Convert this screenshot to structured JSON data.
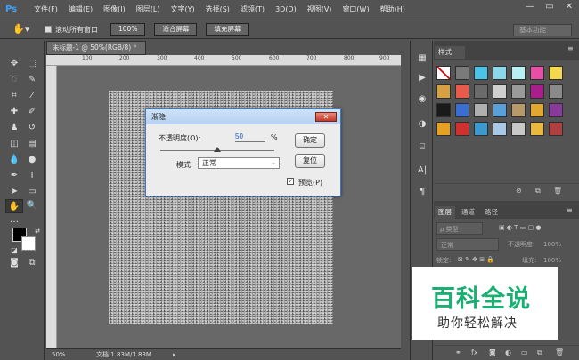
{
  "app": {
    "logo": "Ps",
    "menu": [
      "文件(F)",
      "编辑(E)",
      "图像(I)",
      "图层(L)",
      "文字(Y)",
      "选择(S)",
      "滤镜(T)",
      "3D(D)",
      "视图(V)",
      "窗口(W)",
      "帮助(H)"
    ],
    "window_controls": [
      "—",
      "▭",
      "✕"
    ]
  },
  "options_bar": {
    "scroll_all_windows": "滚动所有窗口",
    "zoom_100": "100%",
    "fit_screen": "适合屏幕",
    "fill_screen": "填充屏幕",
    "workspace": "基本功能"
  },
  "document": {
    "tab_title": "未标题-1 @ 50%(RGB/8) *",
    "ruler_ticks": [
      "100",
      "200",
      "300",
      "400",
      "500",
      "600",
      "700",
      "800",
      "900"
    ],
    "status_zoom": "50%",
    "status_doc": "文档:1.83M/1.83M"
  },
  "dialog": {
    "title": "渐隐",
    "opacity_label": "不透明度(O):",
    "opacity_value": "50",
    "opacity_unit": "%",
    "opacity_fraction": 0.5,
    "mode_label": "模式:",
    "mode_value": "正常",
    "ok": "确定",
    "reset": "复位",
    "preview_label": "预览(P)",
    "preview_checked": true
  },
  "styles_panel": {
    "tab": "样式",
    "swatch_colors": [
      [
        "#f2f2f2",
        "#7a7a7a",
        "#4ac3e6",
        "#8ad8ea",
        "#b7f0f2",
        "#e64fa5",
        "#f2d84a"
      ],
      [
        "#d8a040",
        "#e85a4a",
        "#6a6a6a",
        "#cfcfcf",
        "#9a9a9a",
        "#a81e8c",
        "#8a8a8a"
      ],
      [
        "#1a1a1a",
        "#3a6ed0",
        "#b0b0b0",
        "#5aa0d8",
        "#b89a6a",
        "#e0a830",
        "#8a3a9a"
      ],
      [
        "#e8a020",
        "#d03030",
        "#3a9ad0",
        "#a8c8e8",
        "#c8c8c8",
        "#e8b840",
        "#b04040"
      ]
    ]
  },
  "layers_panel": {
    "tabs": [
      "图层",
      "通道",
      "路径"
    ],
    "kind_label": "ρ 类型",
    "blend_mode": "正常",
    "opacity_label": "不透明度:",
    "opacity_value": "100%",
    "lock_label": "锁定:",
    "fill_label": "填充:",
    "fill_value": "100%"
  },
  "watermark": {
    "title": "百科全说",
    "subtitle": "助你轻松解决"
  }
}
